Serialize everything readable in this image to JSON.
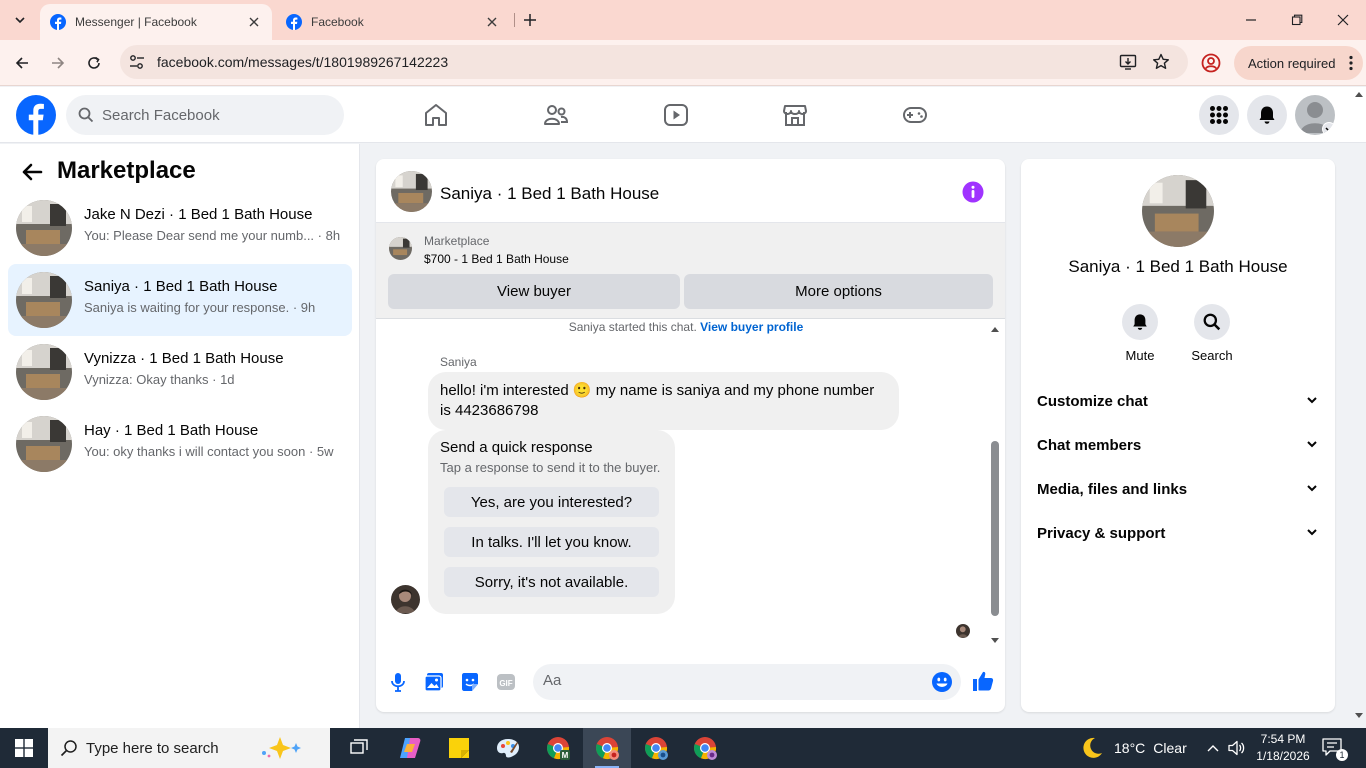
{
  "browser": {
    "tabs": [
      {
        "title": "Messenger | Facebook",
        "active": true
      },
      {
        "title": "Facebook",
        "active": false
      }
    ],
    "url": "facebook.com/messages/t/1801989267142223",
    "action_required": "Action required"
  },
  "fb": {
    "search_placeholder": "Search Facebook",
    "nav_icons": [
      "home-icon",
      "friends-icon",
      "watch-icon",
      "marketplace-icon",
      "gaming-icon"
    ],
    "brand_color": "#0866ff"
  },
  "sidebar": {
    "title": "Marketplace",
    "conversations": [
      {
        "name": "Jake N Dezi · 1 Bed 1 Bath House",
        "snippet": "You: Please Dear send me your numb... · 8h",
        "selected": false
      },
      {
        "name": "Saniya · 1 Bed 1 Bath House",
        "snippet": "Saniya is waiting for your response. · 9h",
        "selected": true
      },
      {
        "name": "Vynizza · 1 Bed 1 Bath House",
        "snippet": "Vynizza: Okay thanks · 1d",
        "selected": false
      },
      {
        "name": "Hay · 1 Bed 1 Bath House",
        "snippet": "You: oky thanks i will contact you soon · 5w",
        "selected": false
      }
    ]
  },
  "chat": {
    "title": "Saniya · 1 Bed 1 Bath House",
    "marketplace_label": "Marketplace",
    "listing": "$700 - 1 Bed 1 Bath House",
    "view_buyer": "View buyer",
    "more_options": "More options",
    "system_text": "Saniya started this chat.",
    "system_link": "View buyer profile",
    "sender": "Saniya",
    "message": "hello! i'm interested 🙂 my name is saniya and my phone number is 4423686798",
    "quick_title": "Send a quick response",
    "quick_sub": "Tap a response to send it to the buyer.",
    "quick_options": [
      "Yes, are you interested?",
      "In talks. I'll let you know.",
      "Sorry, it's not available."
    ],
    "composer_placeholder": "Aa",
    "gif_label": "GIF"
  },
  "details": {
    "title": "Saniya · 1 Bed 1 Bath House",
    "actions": [
      {
        "label": "Mute"
      },
      {
        "label": "Search"
      }
    ],
    "sections": [
      "Customize chat",
      "Chat members",
      "Media, files and links",
      "Privacy & support"
    ]
  },
  "taskbar": {
    "search_placeholder": "Type here to search",
    "temperature": "18°C",
    "weather": "Clear",
    "time": "7:54 PM",
    "date": "1/18/2026",
    "notifications": "1"
  }
}
